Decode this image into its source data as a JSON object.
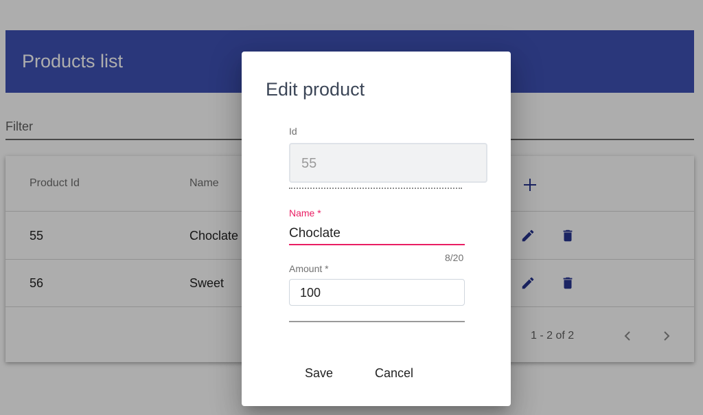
{
  "page": {
    "title": "Products list",
    "filter_label": "Filter"
  },
  "table": {
    "headers": {
      "product_id": "Product Id",
      "name": "Name"
    },
    "rows": [
      {
        "id": "55",
        "name": "Choclate"
      },
      {
        "id": "56",
        "name": "Sweet"
      }
    ],
    "paginator": "1 - 2 of 2"
  },
  "icons": {
    "add": "add-icon",
    "edit": "edit-icon",
    "delete": "delete-icon",
    "prev": "chevron-left-icon",
    "next": "chevron-right-icon"
  },
  "dialog": {
    "title": "Edit product",
    "id_label": "Id",
    "id_value": "55",
    "name_label": "Name *",
    "name_value": "Choclate",
    "name_counter": "8/20",
    "amount_label": "Amount *",
    "amount_value": "100",
    "save_label": "Save",
    "cancel_label": "Cancel"
  },
  "colors": {
    "primary": "#3f51b5",
    "accent": "#e91e63",
    "icon": "#283593"
  }
}
